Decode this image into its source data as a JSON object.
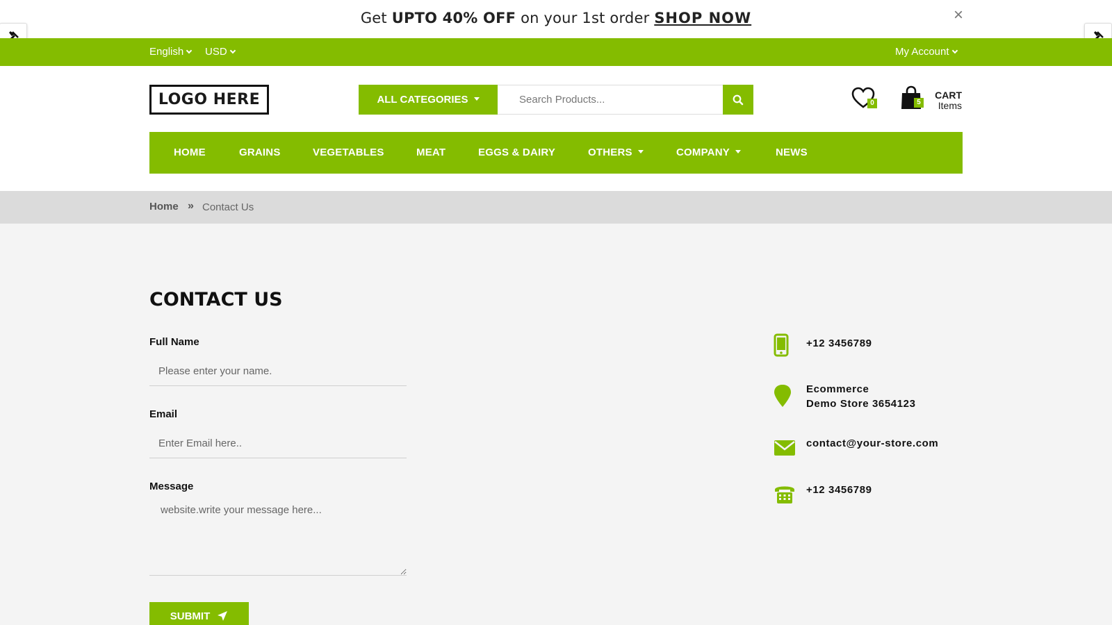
{
  "promo": {
    "get": "Get",
    "offer": "UPTO 40% OFF",
    "middle": "on your 1st order",
    "cta": "SHOP NOW",
    "close": "×"
  },
  "topbar": {
    "language": "English",
    "currency": "USD",
    "account": "My Account"
  },
  "header": {
    "logo": "LOGO HERE",
    "categories": "ALL CATEGORIES",
    "search_placeholder": "Search Products...",
    "wishlist_count": "0",
    "cart_count": "5",
    "cart_label": "CART",
    "cart_sub": "Items"
  },
  "nav": {
    "items": [
      "HOME",
      "GRAINS",
      "VEGETABLES",
      "MEAT",
      "EGGS & DAIRY",
      "OTHERS",
      "COMPANY",
      "NEWS"
    ]
  },
  "breadcrumb": {
    "home": "Home",
    "current": "Contact Us"
  },
  "contact": {
    "title": "CONTACT US",
    "name_label": "Full Name",
    "name_placeholder": "Please enter your name.",
    "email_label": "Email",
    "email_placeholder": "Enter Email here..",
    "message_label": "Message",
    "message_placeholder": "website.write your message here...",
    "submit": "SUBMIT"
  },
  "info": {
    "mobile": "+12 3456789",
    "address_line1": "Ecommerce",
    "address_line2": "Demo Store 3654123",
    "email": "contact@your-store.com",
    "phone": "+12 3456789"
  },
  "colors": {
    "accent": "#84bc00",
    "breadcrumb_bg": "#dbdbdb",
    "page_bg": "#f4f4f4"
  }
}
